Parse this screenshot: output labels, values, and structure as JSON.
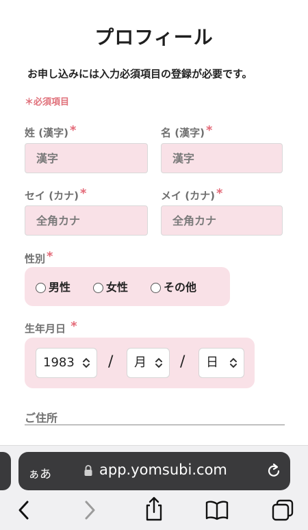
{
  "page": {
    "title": "プロフィール",
    "notice": "お申し込みには入力必須項目の登録が必要です。",
    "required_note": "＊必須項目",
    "required_star": "*"
  },
  "name": {
    "last_kanji_label": "姓 (漢字)",
    "last_kanji_placeholder": "漢字",
    "first_kanji_label": "名 (漢字)",
    "first_kanji_placeholder": "漢字",
    "last_kana_label": "セイ (カナ)",
    "last_kana_placeholder": "全角カナ",
    "first_kana_label": "メイ (カナ)",
    "first_kana_placeholder": "全角カナ"
  },
  "gender": {
    "label": "性別",
    "options": [
      "男性",
      "女性",
      "その他"
    ]
  },
  "birthday": {
    "label": "生年月日",
    "year": "1983",
    "month": "月",
    "day": "日",
    "separator": "/"
  },
  "address": {
    "label": "ご住所"
  },
  "browser": {
    "aa_label": "ぁあ",
    "url": "app.yomsubi.com"
  },
  "colors": {
    "accent_pink": "#f9e1e7",
    "required_red": "#e46a78",
    "url_bar": "#3a3a3c"
  },
  "icons": [
    "lock-icon",
    "reload-icon",
    "back-icon",
    "forward-icon",
    "share-icon",
    "bookmarks-icon",
    "tabs-icon",
    "chevron-updown-icon"
  ]
}
